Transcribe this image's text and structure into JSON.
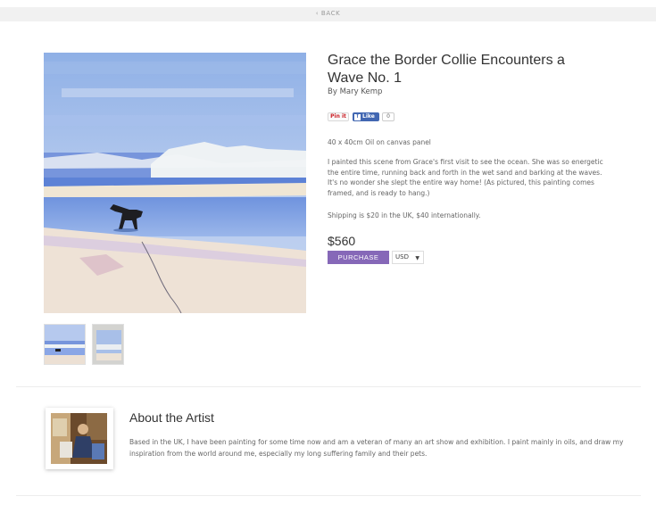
{
  "nav": {
    "back_label": "‹ BACK"
  },
  "product": {
    "title": "Grace the Border Collie Encounters a Wave No. 1",
    "artist_line": "By Mary Kemp",
    "dimensions": "40 x 40cm Oil on canvas panel",
    "description": "I painted this scene from Grace's first visit to see the ocean. She was so energetic the entire time, running back and forth in the wet sand and barking at the waves. It's no wonder she slept the entire way home! (As pictured, this painting comes framed, and is ready to hang.)",
    "shipping": "Shipping is $20 in the UK, $40 internationally.",
    "price": "$560",
    "purchase_label": "PURCHASE",
    "currency": "USD",
    "thumbnails": [
      "painting-thumbnail",
      "framed-painting-thumbnail"
    ]
  },
  "social": {
    "pin_label": "Pin it",
    "fb_icon": "f",
    "fb_label": "Like",
    "fb_count": "0"
  },
  "about": {
    "heading": "About the Artist",
    "text": "Based in the UK, I have been painting for some time now and am a veteran of many an art show and exhibition. I paint mainly in oils, and draw my inspiration from the world around me, especially my long suffering family and their pets."
  },
  "colors": {
    "accent": "#8668b8",
    "facebook": "#4267b2",
    "pinterest": "#cb2027"
  }
}
